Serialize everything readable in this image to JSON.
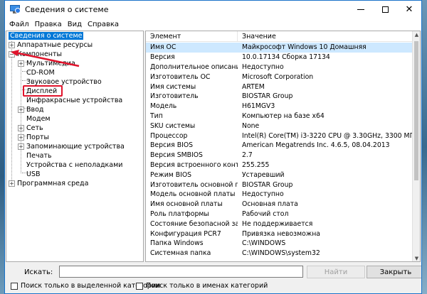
{
  "window": {
    "title": "Сведения о системе"
  },
  "menu": [
    "Файл",
    "Правка",
    "Вид",
    "Справка"
  ],
  "tree": {
    "root": "Сведения о системе",
    "hardware": "Аппаратные ресурсы",
    "components": "Компоненты",
    "children": [
      "Мультимедиа",
      "CD-ROM",
      "Звуковое устройство",
      "Дисплей",
      "Инфракрасные устройства",
      "Ввод",
      "Модем",
      "Сеть",
      "Порты",
      "Запоминающие устройства",
      "Печать",
      "Устройства с неполадками",
      "USB"
    ],
    "software": "Программная среда"
  },
  "table": {
    "headers": [
      "Элемент",
      "Значение"
    ],
    "rows": [
      [
        "Имя ОС",
        "Майкрософт Windows 10 Домашняя"
      ],
      [
        "Версия",
        "10.0.17134 Сборка 17134"
      ],
      [
        "Дополнительное описание ОС",
        "Недоступно"
      ],
      [
        "Изготовитель ОС",
        "Microsoft Corporation"
      ],
      [
        "Имя системы",
        "ARTEM"
      ],
      [
        "Изготовитель",
        "BIOSTAR Group"
      ],
      [
        "Модель",
        "H61MGV3"
      ],
      [
        "Тип",
        "Компьютер на базе x64"
      ],
      [
        "SKU системы",
        "None"
      ],
      [
        "Процессор",
        "Intel(R) Core(TM) i3-3220 CPU @ 3.30GHz, 3300 МГц, ядер: 2, ло"
      ],
      [
        "Версия BIOS",
        "American Megatrends Inc. 4.6.5, 08.04.2013"
      ],
      [
        "Версия SMBIOS",
        "2.7"
      ],
      [
        "Версия встроенного контролл...",
        "255.255"
      ],
      [
        "Режим BIOS",
        "Устаревший"
      ],
      [
        "Изготовитель основной платы",
        "BIOSTAR Group"
      ],
      [
        "Модель основной платы",
        "Недоступно"
      ],
      [
        "Имя основной платы",
        "Основная плата"
      ],
      [
        "Роль платформы",
        "Рабочий стол"
      ],
      [
        "Состояние безопасной загруз...",
        "Не поддерживается"
      ],
      [
        "Конфигурация PCR7",
        "Привязка невозможна"
      ],
      [
        "Папка Windows",
        "C:\\WINDOWS"
      ],
      [
        "Системная папка",
        "C:\\WINDOWS\\system32"
      ]
    ]
  },
  "search": {
    "label": "Искать:",
    "value": "",
    "find_button": "Найти",
    "close_button": "Закрыть",
    "option_selected": "Поиск только в выделенной категории",
    "option_names": "Поиск только в именах категорий"
  },
  "annotation_color": "#e0142c",
  "selection_color": "#0078d7",
  "icons": [
    "app-icon",
    "minimize-icon",
    "maximize-icon",
    "close-icon",
    "expand-icon",
    "red-arrow"
  ]
}
